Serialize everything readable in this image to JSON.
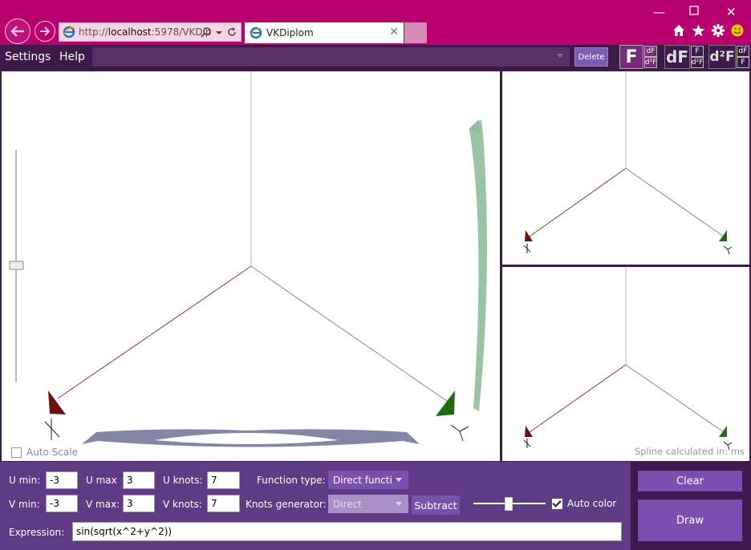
{
  "browser": {
    "url_prefix": "http://",
    "url_host": "localhost",
    "url_rest": ":5978/VKDip",
    "tab_title": "VKDiplom",
    "icons": [
      "back-arrow-icon",
      "forward-arrow-icon",
      "ie-logo-icon",
      "search-icon",
      "refresh-icon",
      "home-icon",
      "star-icon",
      "gear-icon",
      "smiley-icon"
    ]
  },
  "menu": {
    "settings": "Settings",
    "help": "Help",
    "delete": "Delete"
  },
  "modes": {
    "f": "F",
    "f_df": "dF",
    "f_d2f": "d²F",
    "df": "dF",
    "df_f": "F",
    "df_d2f": "d²F",
    "d2f": "d²F",
    "d2f_df": "dF",
    "d2f_f": "F"
  },
  "main": {
    "auto_scale": "Auto Scale",
    "spline_text": "Spline calculated in:  ms"
  },
  "controls": {
    "u_min_label": "U min:",
    "u_min": "-3",
    "u_max_label": "U max",
    "u_max": "3",
    "u_knots_label": "U knots:",
    "u_knots": "7",
    "v_min_label": "V min:",
    "v_min": "-3",
    "v_max_label": "V max:",
    "v_max": "3",
    "v_knots_label": "V knots:",
    "v_knots": "7",
    "function_type_label": "Function type:",
    "function_type": "Direct functi",
    "knots_generator_label": "Knots generator:",
    "knots_generator": "Direct",
    "subtract": "Subtract",
    "auto_color": "Auto color",
    "auto_color_checked": true,
    "expression_label": "Expression:",
    "expression": "sin(sqrt(x^2+y^2))",
    "clear": "Clear",
    "draw": "Draw"
  },
  "colors": {
    "chrome": "#b8006f",
    "app_dark": "#3d1a49",
    "controls_bg": "#5f3b86",
    "button": "#7a4fb0",
    "axis_red": "#6b0f0f",
    "axis_green": "#1e6b10"
  }
}
